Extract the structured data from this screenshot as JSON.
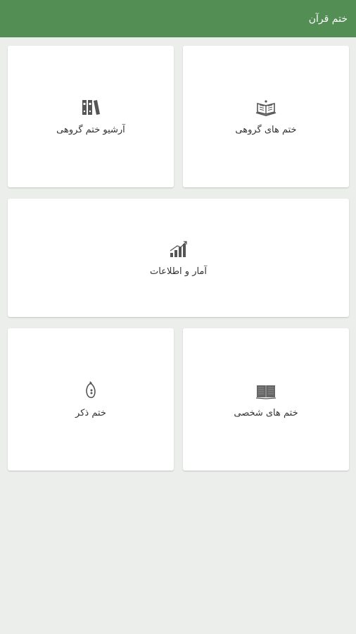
{
  "app_bar": {
    "title": "ختم قرآن",
    "color": "#538f55"
  },
  "cards": {
    "group_khatm": {
      "label": "ختم های گروهی",
      "icon": "open-quran-icon"
    },
    "archive": {
      "label": "آرشیو ختم گروهی",
      "icon": "binders-icon"
    },
    "stats": {
      "label": "آمار و اطلاعات",
      "icon": "bar-chart-icon"
    },
    "personal_khatm": {
      "label": "ختم های شخصی",
      "icon": "open-book-icon"
    },
    "dhikr_khatm": {
      "label": "ختم ذکر",
      "icon": "prayer-beads-icon"
    }
  }
}
